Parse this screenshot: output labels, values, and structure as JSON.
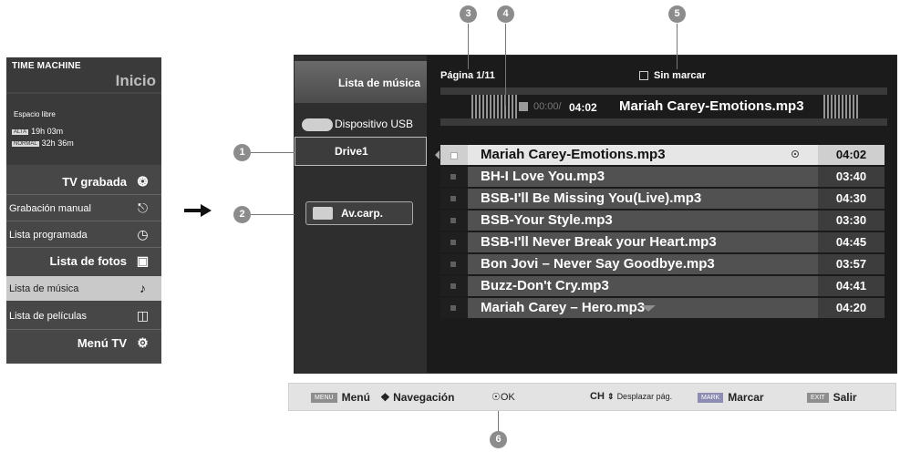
{
  "left_menu": {
    "title": "TIME MACHINE",
    "subtitle": "Inicio",
    "free_space_label": "Espacio libre",
    "quality": [
      {
        "badge": "ALTA",
        "time": "19h 03m"
      },
      {
        "badge": "NORMAL",
        "time": "32h 36m"
      }
    ],
    "items": [
      {
        "label": "TV grabada",
        "icon": "film-reel-icon",
        "style": "big"
      },
      {
        "label": "Grabación manual",
        "icon": "manual-record-icon",
        "style": "small"
      },
      {
        "label": "Lista programada",
        "icon": "scheduled-clock-icon",
        "style": "small"
      },
      {
        "label": "Lista de fotos",
        "icon": "photo-icon",
        "style": "big"
      },
      {
        "label": "Lista de música",
        "icon": "music-note-icon",
        "style": "small",
        "active": true
      },
      {
        "label": "Lista de películas",
        "icon": "movie-icon",
        "style": "small"
      },
      {
        "label": "Menú TV",
        "icon": "settings-gears-icon",
        "style": "big"
      }
    ]
  },
  "screen": {
    "tab_title": "Lista de música",
    "usb_device": "Dispositivo USB",
    "drive": "Drive1",
    "folder_button": "Av.carp.",
    "page_info": "Página 1/11",
    "mark_status": "Sin marcar",
    "player": {
      "elapsed": "00:00/",
      "total": "04:02",
      "now_playing": "Mariah Carey-Emotions.mp3"
    },
    "tracks": [
      {
        "title": "Mariah Carey-Emotions.mp3",
        "duration": "04:02",
        "selected": true
      },
      {
        "title": "BH-I Love You.mp3",
        "duration": "03:40"
      },
      {
        "title": "BSB-I'll Be Missing You(Live).mp3",
        "duration": "04:30"
      },
      {
        "title": "BSB-Your Style.mp3",
        "duration": "03:30"
      },
      {
        "title": "BSB-I'll Never Break your Heart.mp3",
        "duration": "04:45"
      },
      {
        "title": "Bon Jovi – Never Say Goodbye.mp3",
        "duration": "03:57"
      },
      {
        "title": "Buzz-Don't Cry.mp3",
        "duration": "04:41"
      },
      {
        "title": "Mariah Carey – Hero.mp3",
        "duration": "04:20"
      }
    ]
  },
  "bottom_bar": {
    "menu_key": "MENU",
    "menu_label": "Menú",
    "nav_label": "Navegación",
    "ok_label": "OK",
    "ch_key": "CH",
    "page_label": "Desplazar pág.",
    "mark_key": "MARK",
    "mark_label": "Marcar",
    "exit_key": "EXIT",
    "exit_label": "Salir"
  },
  "callouts": [
    "1",
    "2",
    "3",
    "4",
    "5",
    "6"
  ],
  "colors": {
    "screen_bg": "#1b1b1b",
    "row_bg": "#515151",
    "row_selected": "#e6e6e6",
    "callout": "#8c8c8c"
  }
}
